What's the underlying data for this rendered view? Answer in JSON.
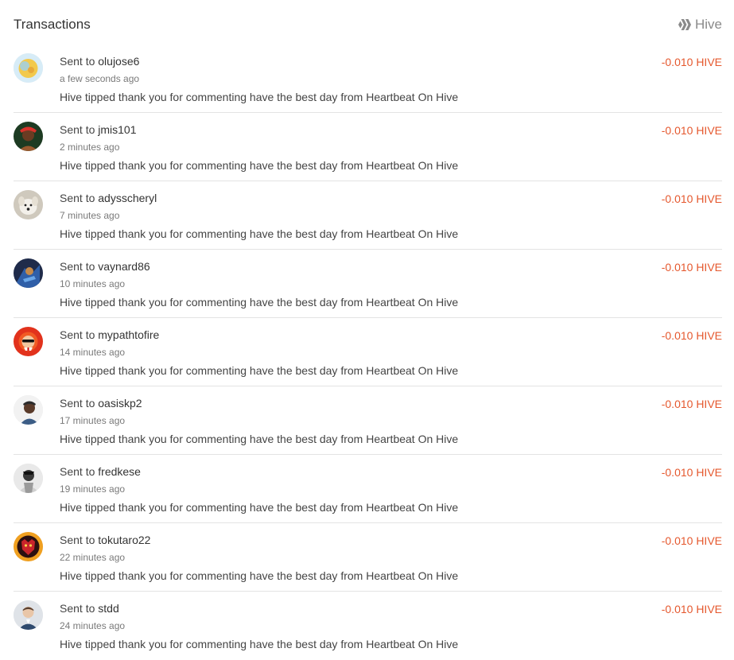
{
  "header": {
    "title": "Transactions",
    "brand_label": "Hive"
  },
  "transactions": [
    {
      "sent_prefix": "Sent to",
      "username": "olujose6",
      "time": "a few seconds ago",
      "memo": "Hive tipped thank you for commenting have the best day from Heartbeat On Hive",
      "amount": "-0.010 HIVE",
      "avatar": "olujose6-avatar"
    },
    {
      "sent_prefix": "Sent to",
      "username": "jmis101",
      "time": "2 minutes ago",
      "memo": "Hive tipped thank you for commenting have the best day from Heartbeat On Hive",
      "amount": "-0.010 HIVE",
      "avatar": "jmis101-avatar"
    },
    {
      "sent_prefix": "Sent to",
      "username": "adysscheryl",
      "time": "7 minutes ago",
      "memo": "Hive tipped thank you for commenting have the best day from Heartbeat On Hive",
      "amount": "-0.010 HIVE",
      "avatar": "adysscheryl-avatar"
    },
    {
      "sent_prefix": "Sent to",
      "username": "vaynard86",
      "time": "10 minutes ago",
      "memo": "Hive tipped thank you for commenting have the best day from Heartbeat On Hive",
      "amount": "-0.010 HIVE",
      "avatar": "vaynard86-avatar"
    },
    {
      "sent_prefix": "Sent to",
      "username": "mypathtofire",
      "time": "14 minutes ago",
      "memo": "Hive tipped thank you for commenting have the best day from Heartbeat On Hive",
      "amount": "-0.010 HIVE",
      "avatar": "mypathtofire-avatar"
    },
    {
      "sent_prefix": "Sent to",
      "username": "oasiskp2",
      "time": "17 minutes ago",
      "memo": "Hive tipped thank you for commenting have the best day from Heartbeat On Hive",
      "amount": "-0.010 HIVE",
      "avatar": "oasiskp2-avatar"
    },
    {
      "sent_prefix": "Sent to",
      "username": "fredkese",
      "time": "19 minutes ago",
      "memo": "Hive tipped thank you for commenting have the best day from Heartbeat On Hive",
      "amount": "-0.010 HIVE",
      "avatar": "fredkese-avatar"
    },
    {
      "sent_prefix": "Sent to",
      "username": "tokutaro22",
      "time": "22 minutes ago",
      "memo": "Hive tipped thank you for commenting have the best day from Heartbeat On Hive",
      "amount": "-0.010 HIVE",
      "avatar": "tokutaro22-avatar"
    },
    {
      "sent_prefix": "Sent to",
      "username": "stdd",
      "time": "24 minutes ago",
      "memo": "Hive tipped thank you for commenting have the best day from Heartbeat On Hive",
      "amount": "-0.010 HIVE",
      "avatar": "stdd-avatar"
    }
  ],
  "colors": {
    "amount": "#e5582e",
    "divider": "#e3e3e3",
    "brand": "#8a8a8a"
  }
}
